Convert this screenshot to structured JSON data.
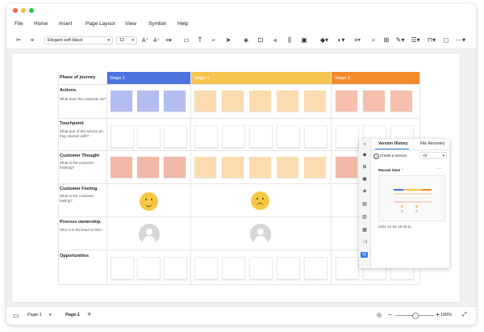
{
  "menu": [
    "File",
    "Home",
    "Insert",
    "Page Layout",
    "View",
    "Symbol",
    "Help"
  ],
  "toolbar": {
    "font_name": "Elegant soft black",
    "font_size": "12"
  },
  "board": {
    "header_label": "Phase of journey",
    "stages": [
      {
        "label": "Stage 1",
        "color": "#4d73df"
      },
      {
        "label": "Stage 2",
        "color": "#f7c44f"
      },
      {
        "label": "Stage 3",
        "color": "#f08a2c"
      }
    ],
    "rows": [
      {
        "title": "Actions",
        "subtitle": "What does the customer do?"
      },
      {
        "title": "Touchpoint",
        "subtitle": "What part of the service do they interact with?"
      },
      {
        "title": "Customer Thought",
        "subtitle": "What is the customer thinking?"
      },
      {
        "title": "Customer Feeling",
        "subtitle": "What is the customer feeling?"
      },
      {
        "title": "Process ownership",
        "subtitle": "Who is in the lead on this?"
      },
      {
        "title": "Opportunities",
        "subtitle": ""
      }
    ],
    "note_colors": {
      "actions": [
        "#b4bdf0",
        "#fbdcb0",
        "#f6bfae"
      ],
      "thought": [
        "#f3b9a8",
        "#fbdcb0",
        "#f3b9a8"
      ]
    }
  },
  "version_panel": {
    "tab_history": "Version History",
    "tab_recovery": "File Recovery",
    "create_label": "Create a Version",
    "filter_value": "All",
    "save_label": "Manual Save",
    "more": "···",
    "timestamp": "2021-11-02 15:46:11"
  },
  "status": {
    "page_selector": "Page-1",
    "active_tab": "Page-1",
    "zoom": "100%"
  }
}
